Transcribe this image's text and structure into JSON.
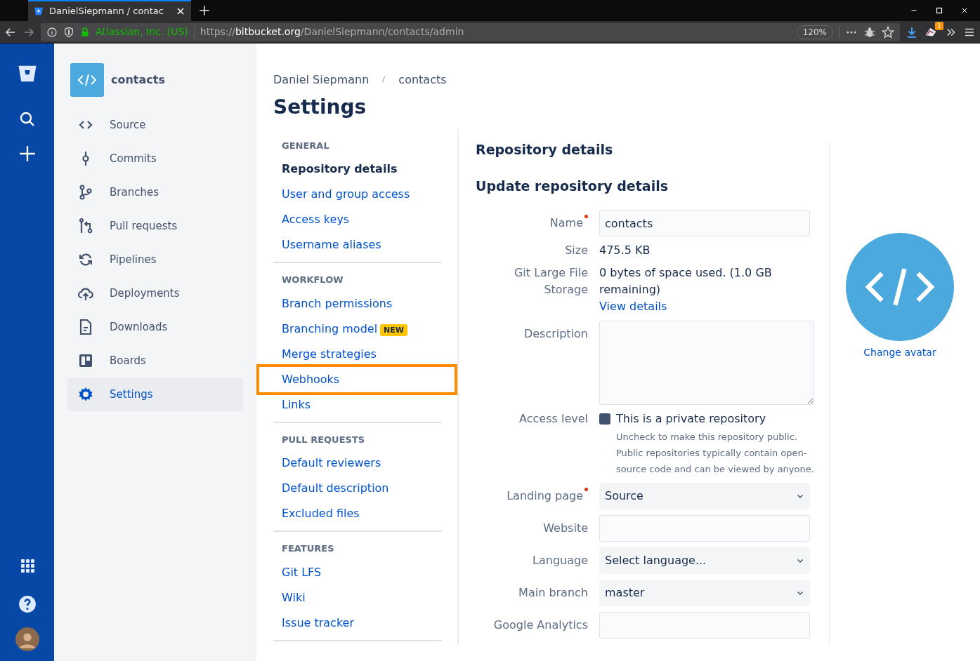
{
  "browser": {
    "tab_title": "DanielSiepmann / contac",
    "identity": "Atlassian, Inc. (US)",
    "url_scheme": "https://",
    "url_host": "bitbucket.org",
    "url_path": "/DanielSiepmann/contacts/admin",
    "zoom": "120%",
    "badge": "1"
  },
  "repo": {
    "name": "contacts"
  },
  "sidebar": {
    "items": [
      {
        "label": "Source",
        "selected": false
      },
      {
        "label": "Commits",
        "selected": false
      },
      {
        "label": "Branches",
        "selected": false
      },
      {
        "label": "Pull requests",
        "selected": false
      },
      {
        "label": "Pipelines",
        "selected": false
      },
      {
        "label": "Deployments",
        "selected": false
      },
      {
        "label": "Downloads",
        "selected": false
      },
      {
        "label": "Boards",
        "selected": false
      },
      {
        "label": "Settings",
        "selected": true
      }
    ]
  },
  "breadcrumbs": [
    "Daniel Siepmann",
    "contacts"
  ],
  "title": "Settings",
  "settings_nav": [
    {
      "heading": "GENERAL",
      "items": [
        {
          "label": "Repository details",
          "selected": true
        },
        {
          "label": "User and group access",
          "selected": false
        },
        {
          "label": "Access keys",
          "selected": false
        },
        {
          "label": "Username aliases",
          "selected": false
        }
      ]
    },
    {
      "heading": "WORKFLOW",
      "items": [
        {
          "label": "Branch permissions",
          "selected": false
        },
        {
          "label": "Branching model",
          "selected": false,
          "badge": "NEW"
        },
        {
          "label": "Merge strategies",
          "selected": false
        },
        {
          "label": "Webhooks",
          "selected": false,
          "highlighted": true
        },
        {
          "label": "Links",
          "selected": false
        }
      ]
    },
    {
      "heading": "PULL REQUESTS",
      "items": [
        {
          "label": "Default reviewers",
          "selected": false
        },
        {
          "label": "Default description",
          "selected": false
        },
        {
          "label": "Excluded files",
          "selected": false
        }
      ]
    },
    {
      "heading": "FEATURES",
      "items": [
        {
          "label": "Git LFS",
          "selected": false
        },
        {
          "label": "Wiki",
          "selected": false
        },
        {
          "label": "Issue tracker",
          "selected": false
        }
      ]
    }
  ],
  "page_heading": "Repository details",
  "section_heading": "Update repository details",
  "form": [
    {
      "kind": "input",
      "label": "Name",
      "required": true,
      "value": "contacts"
    },
    {
      "kind": "text",
      "label": "Size",
      "value": "475.5 KB"
    },
    {
      "kind": "text",
      "label": "Git Large File Storage",
      "value": "0 bytes of space used. (1.0 GB remaining)",
      "link": "View details"
    },
    {
      "kind": "textarea",
      "label": "Description"
    },
    {
      "kind": "checkbox",
      "label": "Access level",
      "option": "This is a private repository",
      "checked": true,
      "help": "Uncheck to make this repository public. Public repositories typically contain open-source code and can be viewed by anyone."
    },
    {
      "kind": "select",
      "label": "Landing page",
      "required": true,
      "value": "Source"
    },
    {
      "kind": "input",
      "label": "Website"
    },
    {
      "kind": "select",
      "label": "Language",
      "value": "Select language..."
    },
    {
      "kind": "select",
      "label": "Main branch",
      "value": "master"
    },
    {
      "kind": "input",
      "label": "Google Analytics"
    }
  ],
  "avatar": {
    "link": "Change avatar"
  }
}
